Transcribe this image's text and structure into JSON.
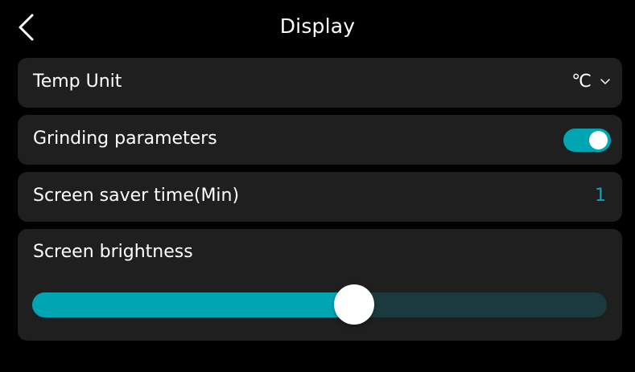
{
  "header": {
    "title": "Display"
  },
  "settings": {
    "temp_unit": {
      "label": "Temp Unit",
      "value": "℃"
    },
    "grinding": {
      "label": "Grinding parameters",
      "enabled": true
    },
    "screen_saver": {
      "label": "Screen saver time(Min)",
      "value": "1"
    },
    "brightness": {
      "label": "Screen brightness",
      "level_fraction": 0.56
    }
  },
  "colors": {
    "accent": "#00a5b3",
    "card_bg": "#1f1f1f",
    "page_bg": "#000000",
    "slider_track": "#1a3a3d"
  },
  "icons": {
    "back": "chevron-left-icon",
    "dropdown": "chevron-down-icon"
  }
}
